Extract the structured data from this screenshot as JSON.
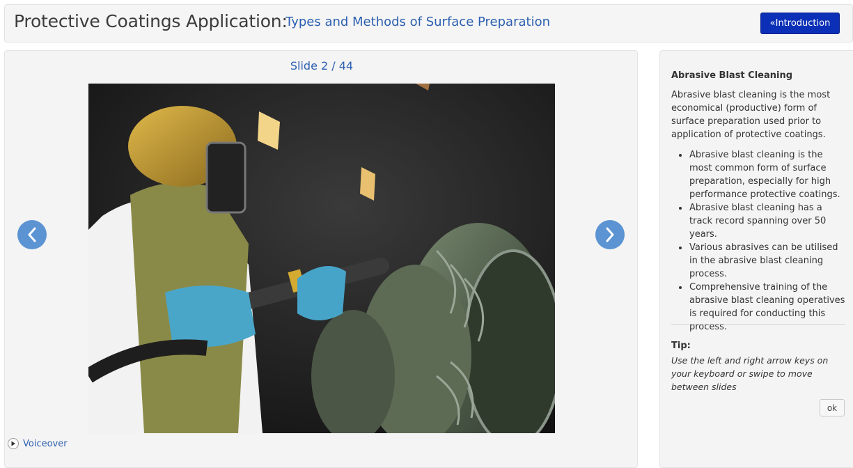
{
  "header": {
    "title": "Protective Coatings Application:",
    "subtitle": "Types and Methods of Surface Preparation",
    "intro_button": "«Introduction"
  },
  "slide": {
    "counter": "Slide 2 / 44",
    "image": "abrasive-blast-cleaning-photo",
    "voiceover_label": "Voiceover"
  },
  "info": {
    "heading": "Abrasive Blast Cleaning",
    "intro": "Abrasive blast cleaning is the most economical (productive) form of surface preparation used prior to application of protective coatings.",
    "bullets": [
      "Abrasive blast cleaning is the most common form of surface preparation, especially for high performance protective coatings.",
      "Abrasive blast cleaning has a track record spanning over 50 years.",
      "Various abrasives can be utilised in the abrasive blast cleaning process.",
      "Comprehensive training of the abrasive blast cleaning operatives is required for conducting this process."
    ],
    "tip_label": "Tip:",
    "tip_text": "Use the left and right arrow keys on your keyboard or swipe to move between slides",
    "ok_label": "ok"
  },
  "colors": {
    "accent": "#2b5fb0",
    "intro_button": "#0b2fb6",
    "nav_arrow": "#5b93d3"
  }
}
